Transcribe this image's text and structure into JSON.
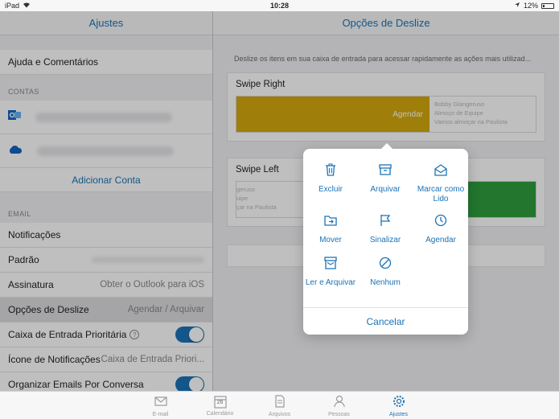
{
  "status": {
    "device": "iPad",
    "time": "10:28",
    "battery": "12%"
  },
  "left": {
    "title": "Ajustes",
    "help_label": "Ajuda e Comentários",
    "accounts_section": "CONTAS",
    "add_account": "Adicionar Conta",
    "email_section": "EMAIL",
    "rows": {
      "notifications": "Notificações",
      "default": "Padrão",
      "signature": "Assinatura",
      "signature_value": "Obter o Outlook para iOS",
      "swipe_options": "Opções de Deslize",
      "swipe_options_value": "Agendar / Arquivar",
      "focused_inbox": "Caixa de Entrada Prioritária",
      "badge_icon": "Ícone de Notificações",
      "badge_icon_value": "Caixa de Entrada Priori...",
      "organize": "Organizar Emails Por Conversa"
    }
  },
  "right": {
    "title": "Opções de Deslize",
    "description": "Deslize os itens em sua caixa de entrada para acessar rapidamente as ações mais utilizad...",
    "swipe_right": {
      "title": "Swipe Right",
      "action": "Agendar",
      "color": "#d4a90c",
      "preview_lines": [
        "Bobby Glangeruso",
        "Almoço de Equipe",
        "Vamos almoçar na Paulista"
      ]
    },
    "swipe_left": {
      "title": "Swipe Left",
      "color": "#2e9e3e",
      "preview_lines": [
        "geruso",
        "uipe",
        "çar na Paulista"
      ]
    }
  },
  "popover": {
    "actions": [
      {
        "label": "Excluir",
        "icon": "trash-icon"
      },
      {
        "label": "Arquivar",
        "icon": "archive-icon"
      },
      {
        "label": "Marcar como Lido",
        "icon": "envelope-open-icon"
      },
      {
        "label": "Mover",
        "icon": "folder-icon"
      },
      {
        "label": "Sinalizar",
        "icon": "flag-icon"
      },
      {
        "label": "Agendar",
        "icon": "clock-icon"
      },
      {
        "label": "Ler e Arquivar",
        "icon": "read-archive-icon"
      },
      {
        "label": "Nenhum",
        "icon": "none-icon"
      }
    ],
    "cancel": "Cancelar"
  },
  "tabs": [
    {
      "label": "E-mail",
      "icon": "mail-icon"
    },
    {
      "label": "Calendário",
      "icon": "calendar-icon",
      "day": "26"
    },
    {
      "label": "Arquivos",
      "icon": "files-icon"
    },
    {
      "label": "Pessoas",
      "icon": "people-icon"
    },
    {
      "label": "Ajustes",
      "icon": "gear-icon"
    }
  ],
  "colors": {
    "accent": "#1a73b8"
  }
}
